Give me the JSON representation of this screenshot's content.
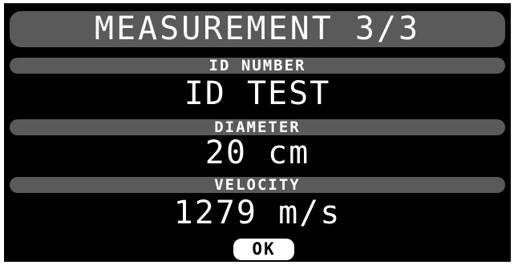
{
  "header": {
    "title": "MEASUREMENT 3/3"
  },
  "fields": {
    "id": {
      "label": "ID NUMBER",
      "value": "ID TEST"
    },
    "diameter": {
      "label": "DIAMETER",
      "value": "20 cm"
    },
    "velocity": {
      "label": "VELOCITY",
      "value": "1279 m/s"
    }
  },
  "actions": {
    "ok_label": "OK"
  },
  "colors": {
    "background": "#000000",
    "bar": "#5a5a5a",
    "text": "#ffffff",
    "button_bg": "#ffffff",
    "button_text": "#000000"
  }
}
